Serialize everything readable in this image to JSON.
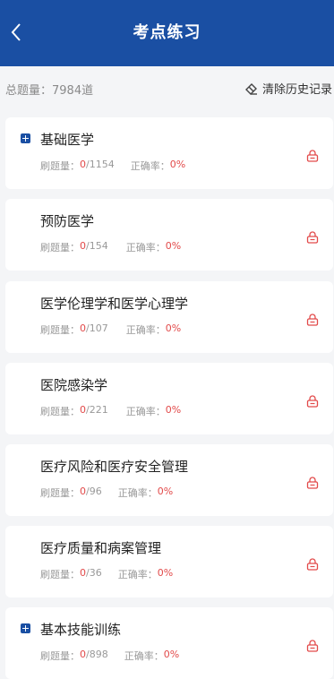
{
  "header": {
    "title": "考点练习",
    "back_icon": "chevron-left-icon"
  },
  "summary": {
    "total_label": "总题量：",
    "total_value": "7984道",
    "clear_label": "清除历史记录",
    "clear_icon": "eraser-icon"
  },
  "labels": {
    "done": "刷题量：",
    "accuracy": "正确率："
  },
  "colors": {
    "brand": "#1a4fa3",
    "accent_red": "#e24a4a"
  },
  "topics": [
    {
      "name": "基础医学",
      "done": "0",
      "total": "/1154",
      "accuracy": "0%",
      "expandable": true,
      "locked": true
    },
    {
      "name": "预防医学",
      "done": "0",
      "total": "/154",
      "accuracy": "0%",
      "expandable": false,
      "locked": true
    },
    {
      "name": "医学伦理学和医学心理学",
      "done": "0",
      "total": "/107",
      "accuracy": "0%",
      "expandable": false,
      "locked": true
    },
    {
      "name": "医院感染学",
      "done": "0",
      "total": "/221",
      "accuracy": "0%",
      "expandable": false,
      "locked": true
    },
    {
      "name": "医疗风险和医疗安全管理",
      "done": "0",
      "total": "/96",
      "accuracy": "0%",
      "expandable": false,
      "locked": true
    },
    {
      "name": "医疗质量和病案管理",
      "done": "0",
      "total": "/36",
      "accuracy": "0%",
      "expandable": false,
      "locked": true
    },
    {
      "name": "基本技能训练",
      "done": "0",
      "total": "/898",
      "accuracy": "0%",
      "expandable": true,
      "locked": true
    }
  ]
}
